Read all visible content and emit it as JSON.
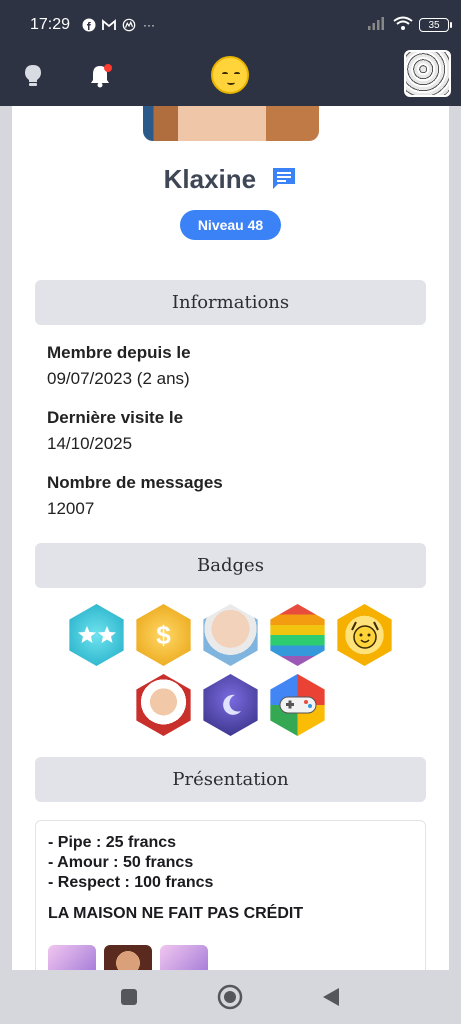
{
  "status_bar": {
    "time": "17:29",
    "battery": "35"
  },
  "app_bar": {
    "logo": "smiley-logo",
    "icons": [
      "lightbulb-icon",
      "bell-icon"
    ]
  },
  "profile": {
    "username": "Klaxine",
    "level_badge": "Niveau 48"
  },
  "sections": {
    "info_title": "Informations",
    "badges_title": "Badges",
    "presentation_title": "Présentation"
  },
  "info": {
    "member_since_label": "Membre depuis le",
    "member_since_value": "09/07/2023 (2 ans)",
    "last_visit_label": "Dernière visite le",
    "last_visit_value": "14/10/2025",
    "messages_label": "Nombre de messages",
    "messages_value": "12007"
  },
  "badges": [
    "stars-badge",
    "dollar-badge",
    "harold-badge",
    "rainbow-badge",
    "smiley-hands-badge",
    "chef-badge",
    "moon-badge",
    "gamepad-badge"
  ],
  "presentation": {
    "lines": [
      "- Pipe : 25 francs",
      "- Amour : 50 francs",
      "- Respect : 100 francs"
    ],
    "credit": "LA MAISON NE FAIT PAS CRÉDIT"
  },
  "colors": {
    "accent": "#3b82f6",
    "header": "#2d3342",
    "section_bg": "#e2e3e8"
  }
}
